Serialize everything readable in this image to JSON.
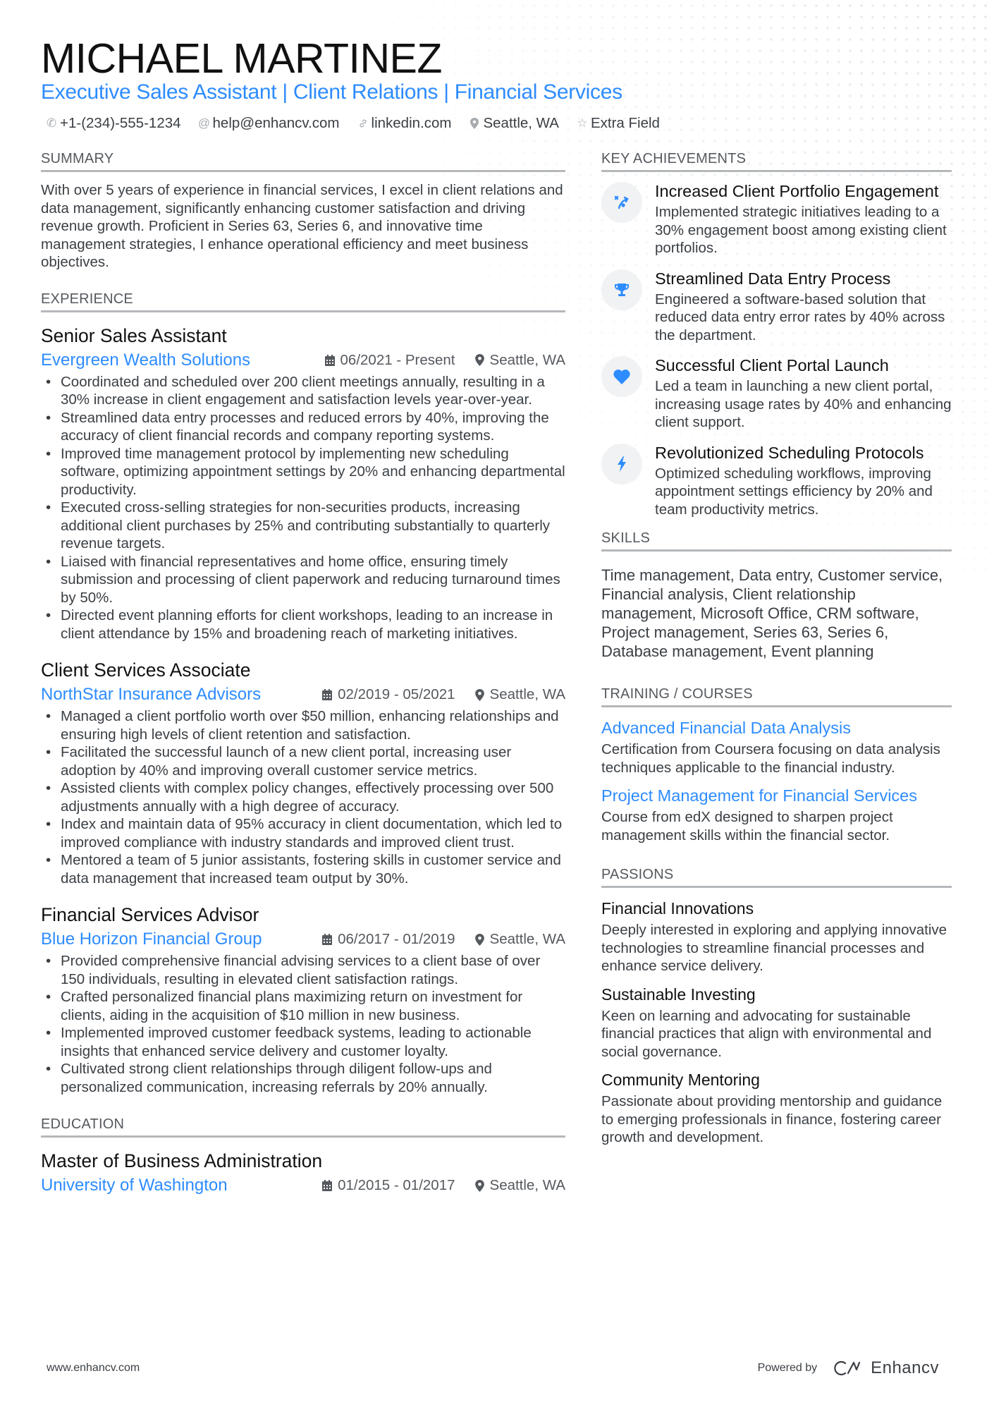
{
  "header": {
    "name": "MICHAEL MARTINEZ",
    "headline": "Executive Sales Assistant | Client Relations | Financial Services",
    "contacts": [
      {
        "icon": "phone-icon",
        "value": "+1-(234)-555-1234"
      },
      {
        "icon": "at-icon",
        "value": "help@enhancv.com"
      },
      {
        "icon": "link-icon",
        "value": "linkedin.com"
      },
      {
        "icon": "location-icon",
        "value": "Seattle, WA"
      },
      {
        "icon": "star-icon",
        "value": "Extra Field"
      }
    ]
  },
  "colors": {
    "accent": "#2d8cff",
    "text": "#3a3f44",
    "heading": "#111111",
    "rule": "#b5b8bb"
  },
  "summary": {
    "title": "SUMMARY",
    "text": "With over 5 years of experience in financial services, I excel in client relations and data management, significantly enhancing customer satisfaction and driving revenue growth. Proficient in Series 63, Series 6, and innovative time management strategies, I enhance operational efficiency and meet business objectives."
  },
  "experience": {
    "title": "EXPERIENCE",
    "jobs": [
      {
        "title": "Senior Sales Assistant",
        "company": "Evergreen Wealth Solutions",
        "dates": "06/2021 - Present",
        "location": "Seattle, WA",
        "bullets": [
          "Coordinated and scheduled over 200 client meetings annually, resulting in a 30% increase in client engagement and satisfaction levels year-over-year.",
          "Streamlined data entry processes and reduced errors by 40%, improving the accuracy of client financial records and company reporting systems.",
          "Improved time management protocol by implementing new scheduling software, optimizing appointment settings by 20% and enhancing departmental productivity.",
          "Executed cross-selling strategies for non-securities products, increasing additional client purchases by 25% and contributing substantially to quarterly revenue targets.",
          "Liaised with financial representatives and home office, ensuring timely submission and processing of client paperwork and reducing turnaround times by 50%.",
          "Directed event planning efforts for client workshops, leading to an increase in client attendance by 15% and broadening reach of marketing initiatives."
        ]
      },
      {
        "title": "Client Services Associate",
        "company": "NorthStar Insurance Advisors",
        "dates": "02/2019 - 05/2021",
        "location": "Seattle, WA",
        "bullets": [
          "Managed a client portfolio worth over $50 million, enhancing relationships and ensuring high levels of client retention and satisfaction.",
          "Facilitated the successful launch of a new client portal, increasing user adoption by 40% and improving overall customer service metrics.",
          "Assisted clients with complex policy changes, effectively processing over 500 adjustments annually with a high degree of accuracy.",
          "Index and maintain data of 95% accuracy in client documentation, which led to improved compliance with industry standards and improved client trust.",
          "Mentored a team of 5 junior assistants, fostering skills in customer service and data management that increased team output by 30%."
        ]
      },
      {
        "title": "Financial Services Advisor",
        "company": "Blue Horizon Financial Group",
        "dates": "06/2017 - 01/2019",
        "location": "Seattle, WA",
        "bullets": [
          "Provided comprehensive financial advising services to a client base of over 150 individuals, resulting in elevated client satisfaction ratings.",
          "Crafted personalized financial plans maximizing return on investment for clients, aiding in the acquisition of $10 million in new business.",
          "Implemented improved customer feedback systems, leading to actionable insights that enhanced service delivery and customer loyalty.",
          "Cultivated strong client relationships through diligent follow-ups and personalized communication, increasing referrals by 20% annually."
        ]
      }
    ]
  },
  "education": {
    "title": "EDUCATION",
    "items": [
      {
        "degree": "Master of Business Administration",
        "school": "University of Washington",
        "dates": "01/2015 - 01/2017",
        "location": "Seattle, WA"
      }
    ]
  },
  "achievements": {
    "title": "KEY ACHIEVEMENTS",
    "items": [
      {
        "icon": "strategy-icon",
        "title": "Increased Client Portfolio Engagement",
        "desc": "Implemented strategic initiatives leading to a 30% engagement boost among existing client portfolios."
      },
      {
        "icon": "trophy-icon",
        "title": "Streamlined Data Entry Process",
        "desc": "Engineered a software-based solution that reduced data entry error rates by 40% across the department."
      },
      {
        "icon": "heart-icon",
        "title": "Successful Client Portal Launch",
        "desc": "Led a team in launching a new client portal, increasing usage rates by 40% and enhancing client support."
      },
      {
        "icon": "bolt-icon",
        "title": "Revolutionized Scheduling Protocols",
        "desc": "Optimized scheduling workflows, improving appointment settings efficiency by 20% and team productivity metrics."
      }
    ]
  },
  "skills": {
    "title": "SKILLS",
    "text": "Time management, Data entry, Customer service, Financial analysis, Client relationship management, Microsoft Office, CRM software, Project management, Series 63, Series 6, Database management, Event planning"
  },
  "training": {
    "title": "TRAINING / COURSES",
    "items": [
      {
        "title": "Advanced Financial Data Analysis",
        "desc": "Certification from Coursera focusing on data analysis techniques applicable to the financial industry."
      },
      {
        "title": "Project Management for Financial Services",
        "desc": "Course from edX designed to sharpen project management skills within the financial sector."
      }
    ]
  },
  "passions": {
    "title": "PASSIONS",
    "items": [
      {
        "title": "Financial Innovations",
        "desc": "Deeply interested in exploring and applying innovative technologies to streamline financial processes and enhance service delivery."
      },
      {
        "title": "Sustainable Investing",
        "desc": "Keen on learning and advocating for sustainable financial practices that align with environmental and social governance."
      },
      {
        "title": "Community Mentoring",
        "desc": "Passionate about providing mentorship and guidance to emerging professionals in finance, fostering career growth and development."
      }
    ]
  },
  "footer": {
    "website": "www.enhancv.com",
    "powered_by": "Powered by",
    "brand": "Enhancv"
  }
}
